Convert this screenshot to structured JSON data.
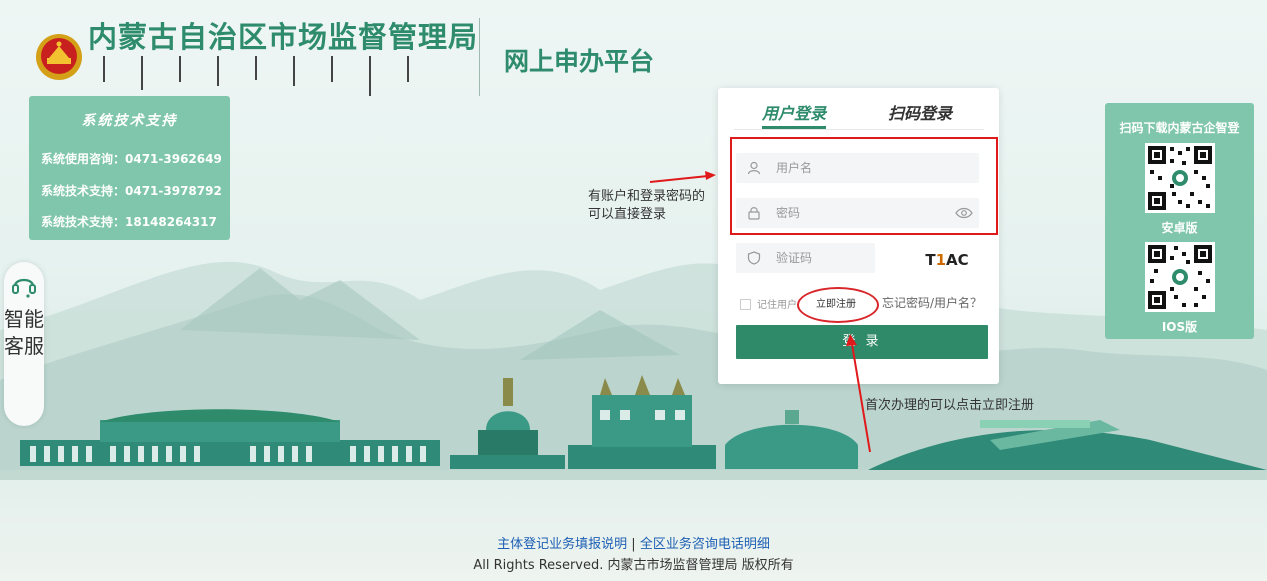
{
  "header": {
    "org_title": "内蒙古自治区市场监督管理局",
    "platform_title": "网上申办平台"
  },
  "support": {
    "title": "系统技术支持",
    "lines": [
      "系统使用咨询：0471-3962649",
      "系统技术支持：0471-3978792",
      "系统技术支持：18148264317"
    ]
  },
  "smart_service": {
    "label": "智能客服"
  },
  "login": {
    "tab_user": "用户登录",
    "tab_scan": "扫码登录",
    "username_placeholder": "用户名",
    "password_placeholder": "密码",
    "captcha_placeholder": "验证码",
    "captcha_code_a": "T",
    "captcha_code_b": "1",
    "captcha_code_c": "AC",
    "remember_label": "记住用户",
    "register_label": "立即注册",
    "forgot_label": "忘记密码/用户名？",
    "login_button": "登 录"
  },
  "annotations": {
    "note_account_line1": "有账户和登录密码的",
    "note_account_line2": "可以直接登录",
    "note_register": "首次办理的可以点击立即注册",
    "highlight_color": "#e0191b"
  },
  "app_download": {
    "title": "扫码下载内蒙古企智登",
    "android_label": "安卓版",
    "ios_label": "IOS版"
  },
  "footer": {
    "link_guide": "主体登记业务填报说明",
    "separator": "|",
    "link_phone": "全区业务咨询电话明细",
    "copyright": "All Rights Reserved. 内蒙古市场监督管理局 版权所有"
  },
  "colors": {
    "brand_green": "#2e8c6d",
    "panel_green": "#7fc6ac",
    "link_blue": "#1c5fb4"
  }
}
